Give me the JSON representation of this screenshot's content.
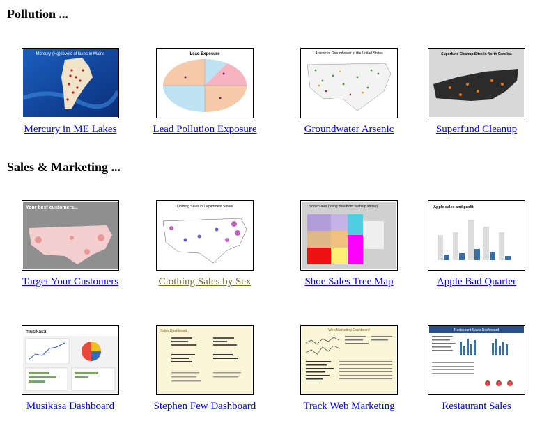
{
  "sections": [
    {
      "heading": "Pollution ...",
      "items": [
        {
          "caption": "Mercury in ME Lakes",
          "thumb_title": "Mercury (Hg) levels of lakes in Maine"
        },
        {
          "caption": "Lead Pollution Exposure",
          "thumb_title": "Lead Exposure"
        },
        {
          "caption": "Groundwater Arsenic",
          "thumb_title": "Arsenic in Groundwater in the United States"
        },
        {
          "caption": "Superfund Cleanup",
          "thumb_title": "Superfund Cleanup Sites in North Carolina"
        }
      ]
    },
    {
      "heading": "Sales & Marketing ...",
      "items": [
        {
          "caption": "Target Your Customers",
          "thumb_title": "Your best customers..."
        },
        {
          "caption": "Clothing Sales by Sex",
          "thumb_title": "Clothing Sales in Department Stores",
          "visited": true
        },
        {
          "caption": "Shoe Sales Tree Map",
          "thumb_title": "Shoe Sales (using data from sashelp.shoes)"
        },
        {
          "caption": "Apple Bad Quarter",
          "thumb_title": "Apple sales and profit"
        }
      ]
    },
    {
      "heading": "",
      "items": [
        {
          "caption": "Musikasa Dashboard",
          "thumb_title": "musikasa"
        },
        {
          "caption": "Stephen Few Dashboard",
          "thumb_title": "Sales Dashboard"
        },
        {
          "caption": "Track Web Marketing",
          "thumb_title": "Web Marketing Dashboard"
        },
        {
          "caption": "Restaurant Sales",
          "thumb_title": "Restaurant Sales Dashboard"
        }
      ]
    }
  ],
  "colors": {
    "link": "#0000ee",
    "visited_link": "#6b6b2a"
  }
}
